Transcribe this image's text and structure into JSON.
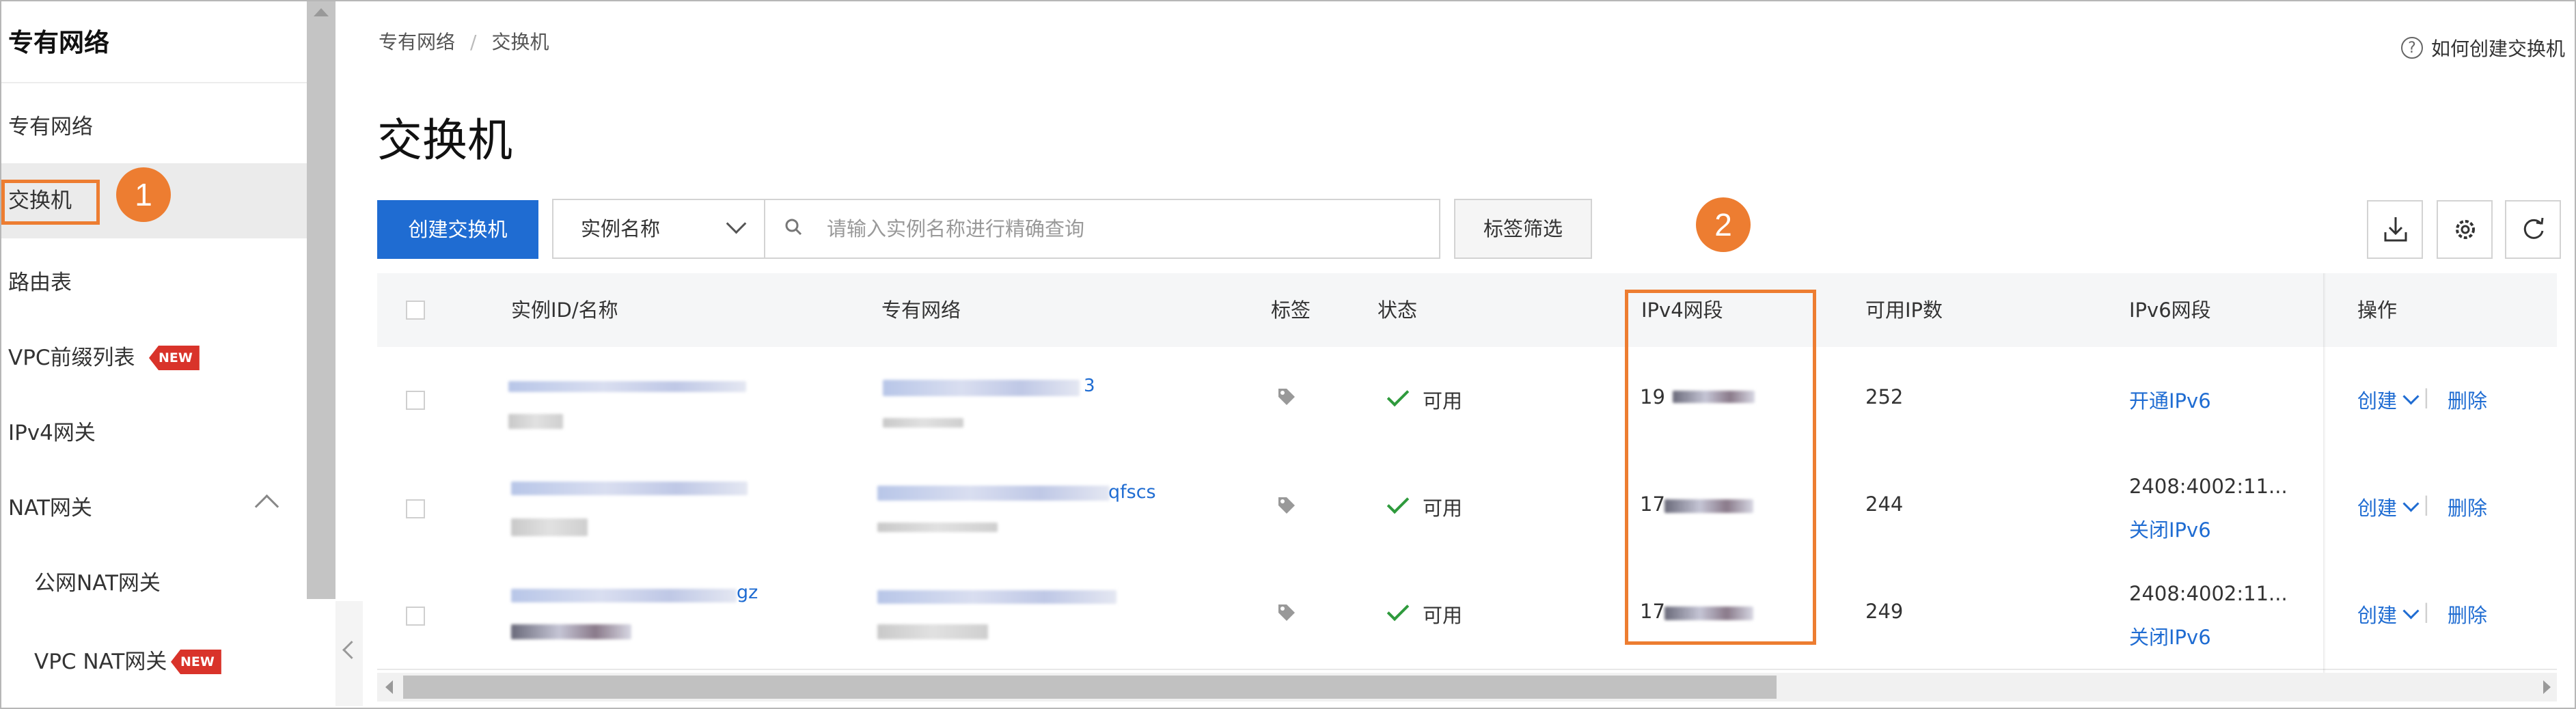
{
  "sidebar": {
    "title": "专有网络",
    "items": [
      {
        "label": "专有网络"
      },
      {
        "label": "交换机"
      },
      {
        "label": "路由表"
      },
      {
        "label": "VPC前缀列表",
        "badge": "NEW"
      },
      {
        "label": "IPv4网关"
      },
      {
        "label": "NAT网关"
      },
      {
        "label": "公网NAT网关"
      },
      {
        "label": "VPC NAT网关",
        "badge": "NEW"
      }
    ]
  },
  "annotations": {
    "one": "1",
    "two": "2",
    "color": "#ed7d31"
  },
  "breadcrumb": {
    "parent": "专有网络",
    "sep": "/",
    "current": "交换机"
  },
  "help": {
    "icon": "?",
    "label": "如何创建交换机"
  },
  "page": {
    "title": "交换机"
  },
  "toolbar": {
    "create_label": "创建交换机",
    "filter_select": "实例名称",
    "search_placeholder": "请输入实例名称进行精确查询",
    "tag_filter_label": "标签筛选",
    "icons": [
      "download-icon",
      "settings-icon",
      "refresh-icon"
    ]
  },
  "table": {
    "columns": [
      "实例ID/名称",
      "专有网络",
      "标签",
      "状态",
      "IPv4网段",
      "可用IP数",
      "IPv6网段",
      "操作"
    ],
    "rows": [
      {
        "vpc_suffix": "3",
        "status": "可用",
        "ipv4_prefix": "19",
        "available_ip": "252",
        "ipv6_cidr": "",
        "ipv6_action": "开通IPv6",
        "op_create": "创建",
        "op_delete": "删除"
      },
      {
        "vpc_suffix": "qfscs",
        "status": "可用",
        "ipv4_prefix": "17",
        "available_ip": "244",
        "ipv6_cidr": "2408:4002:11...",
        "ipv6_action": "关闭IPv6",
        "op_create": "创建",
        "op_delete": "删除"
      },
      {
        "id_suffix": "gz",
        "status": "可用",
        "ipv4_prefix": "17",
        "available_ip": "249",
        "ipv6_cidr": "2408:4002:11...",
        "ipv6_action": "关闭IPv6",
        "op_create": "创建",
        "op_delete": "删除"
      }
    ]
  },
  "colors": {
    "primary": "#1f6cd2",
    "new_badge": "#d9332a",
    "status_ok": "#2e9a3c",
    "annotation": "#ed7d31"
  }
}
